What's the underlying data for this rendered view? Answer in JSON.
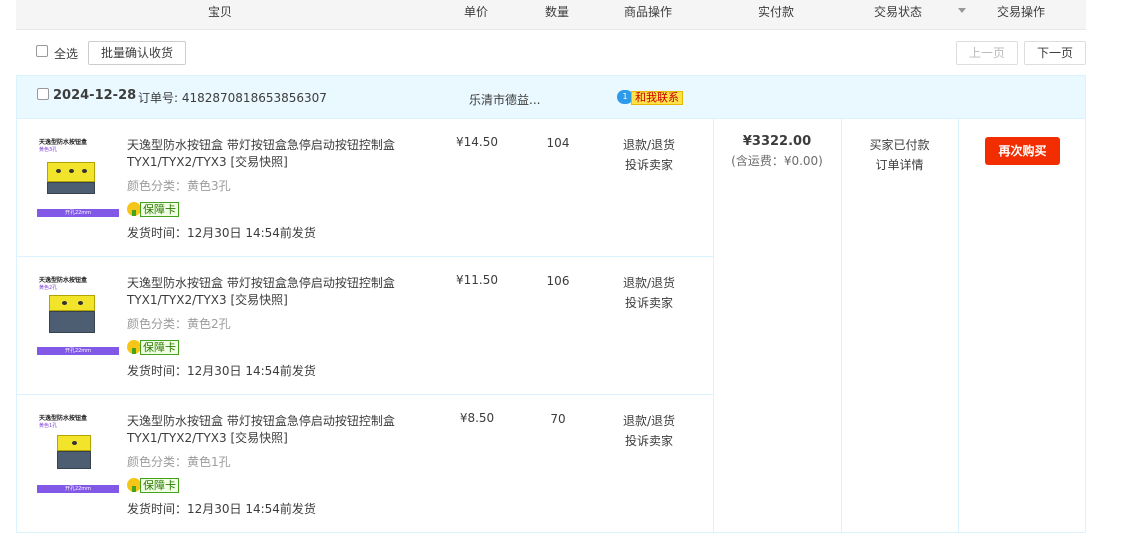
{
  "header": {
    "columns": [
      {
        "label": "宝贝"
      },
      {
        "label": "单价"
      },
      {
        "label": "数量"
      },
      {
        "label": "商品操作"
      },
      {
        "label": "实付款"
      },
      {
        "label": "交易状态"
      },
      {
        "label": "交易操作"
      }
    ]
  },
  "toolbar": {
    "select_all_label": "全选",
    "batch_confirm_label": "批量确认收货",
    "prev_page_label": "上一页",
    "next_page_label": "下一页"
  },
  "order": {
    "date": "2024-12-28",
    "order_no": "订单号: 4182870818653856307",
    "shop_name": "乐清市德益...",
    "contact_badge_count": "1",
    "contact_label": "和我联系",
    "total_amount": "¥3322.00",
    "shipping_note": "(含运费：¥0.00)",
    "status": [
      "买家已付款",
      "订单详情"
    ],
    "rebuy_label": "再次购买",
    "items": [
      {
        "title": "天逸型防水按钮盒 带灯按钮盒急停启动按钮控制盒TYX1/TYX2/TYX3 [交易快照]",
        "spec": "颜色分类：黄色3孔",
        "badge": "保障卡",
        "ship": "发货时间：12月30日 14:54前发货",
        "price": "¥14.50",
        "qty": "104",
        "ops": [
          "退款/退货",
          "投诉卖家"
        ],
        "thumb_title": "天逸型防水按钮盒",
        "thumb_sub": "黄色3孔",
        "thumb_strip": "开孔22mm"
      },
      {
        "title": "天逸型防水按钮盒 带灯按钮盒急停启动按钮控制盒TYX1/TYX2/TYX3 [交易快照]",
        "spec": "颜色分类：黄色2孔",
        "badge": "保障卡",
        "ship": "发货时间：12月30日 14:54前发货",
        "price": "¥11.50",
        "qty": "106",
        "ops": [
          "退款/退货",
          "投诉卖家"
        ],
        "thumb_title": "天逸型防水按钮盒",
        "thumb_sub": "黄色2孔",
        "thumb_strip": "开孔22mm"
      },
      {
        "title": "天逸型防水按钮盒 带灯按钮盒急停启动按钮控制盒TYX1/TYX2/TYX3 [交易快照]",
        "spec": "颜色分类：黄色1孔",
        "badge": "保障卡",
        "ship": "发货时间：12月30日 14:54前发货",
        "price": "¥8.50",
        "qty": "70",
        "ops": [
          "退款/退货",
          "投诉卖家"
        ],
        "thumb_title": "天逸型防水按钮盒",
        "thumb_sub": "黄色1孔",
        "thumb_strip": "开孔22mm"
      }
    ]
  },
  "colors": {
    "accent_orange": "#f22e00",
    "order_head_bg": "#eaf8ff",
    "border_blue": "#daf3ff",
    "header_bg": "#f5f5f5"
  }
}
